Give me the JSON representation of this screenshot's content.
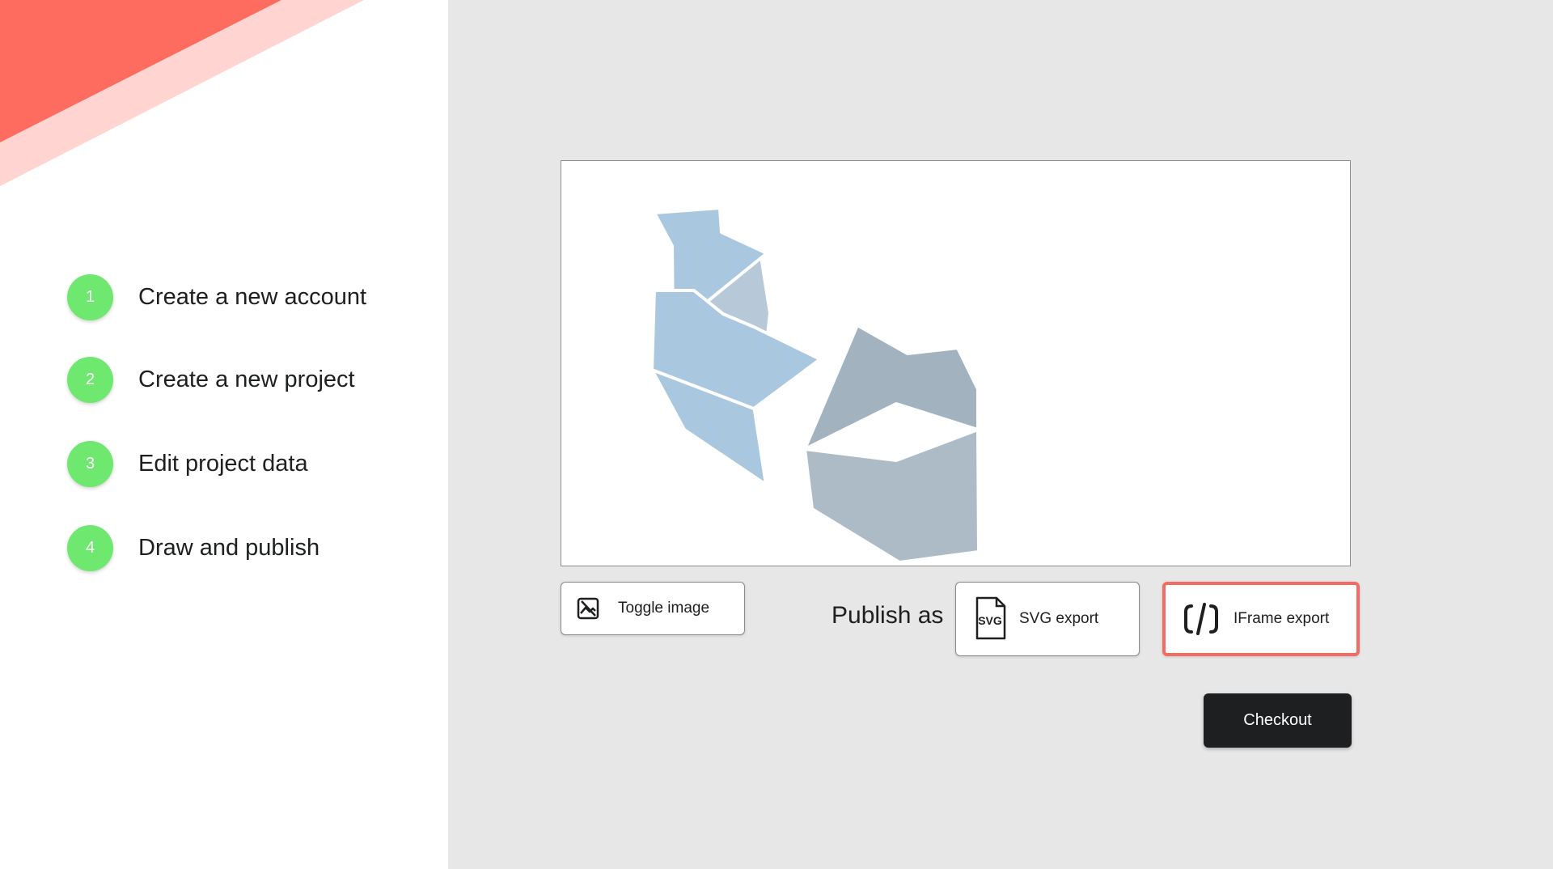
{
  "theme": {
    "accent": "#fe6b5f",
    "accent_light": "#ffd4d1",
    "step_color": "#6ee86e",
    "main_bg": "#e7e7e7",
    "dark": "#1d1f20"
  },
  "steps": [
    {
      "number": "1",
      "label": "Create a new account"
    },
    {
      "number": "2",
      "label": "Create a new project"
    },
    {
      "number": "3",
      "label": "Edit project data"
    },
    {
      "number": "4",
      "label": "Draw and publish"
    }
  ],
  "canvas": {
    "shapes": [
      {
        "name": "blue-prism",
        "color": "#a9c8e0"
      },
      {
        "name": "gray-prism",
        "color": "#a2b2bf"
      }
    ]
  },
  "toolbar": {
    "toggle_label": "Toggle image",
    "toggle_icon": "image-toggle-icon",
    "publish_label": "Publish as",
    "svg_export_label": "SVG export",
    "svg_icon": "svg-file-icon",
    "iframe_export_label": "IFrame export",
    "iframe_icon": "code-brackets-icon",
    "iframe_selected": true
  },
  "checkout": {
    "label": "Checkout"
  }
}
